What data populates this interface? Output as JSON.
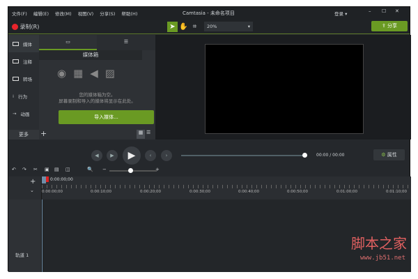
{
  "menu": [
    "文件(F)",
    "编辑(E)",
    "修改(M)",
    "视图(V)",
    "分享(S)",
    "帮助(H)"
  ],
  "title": "Camtasia - 未命名项目",
  "login": "登录 ▾",
  "record": "录制(R)",
  "zoom": "20%",
  "share": "分享",
  "side_tabs": [
    "媒体",
    "注释",
    "转场",
    "行为",
    "动画"
  ],
  "more": "更多",
  "panel": {
    "title": "媒体箱",
    "empty1": "您的媒体箱为空。",
    "empty2": "屏幕录制和导入的媒体将显示在此处。",
    "import": "导入媒体..."
  },
  "time": {
    "current": "00:00",
    "sep": "/",
    "total": "00:00"
  },
  "properties": "属性",
  "playhead": "0:00:00;00",
  "ticks": [
    "0:00:00;00",
    "0:00:10;00",
    "0:00:20;00",
    "0:00:30;00",
    "0:00:40;00",
    "0:00:50;00",
    "0:01:00;00",
    "0:01:10;00"
  ],
  "track": "轨道 1",
  "watermark": {
    "name": "脚本之家",
    "url": "www.jb51.net"
  }
}
